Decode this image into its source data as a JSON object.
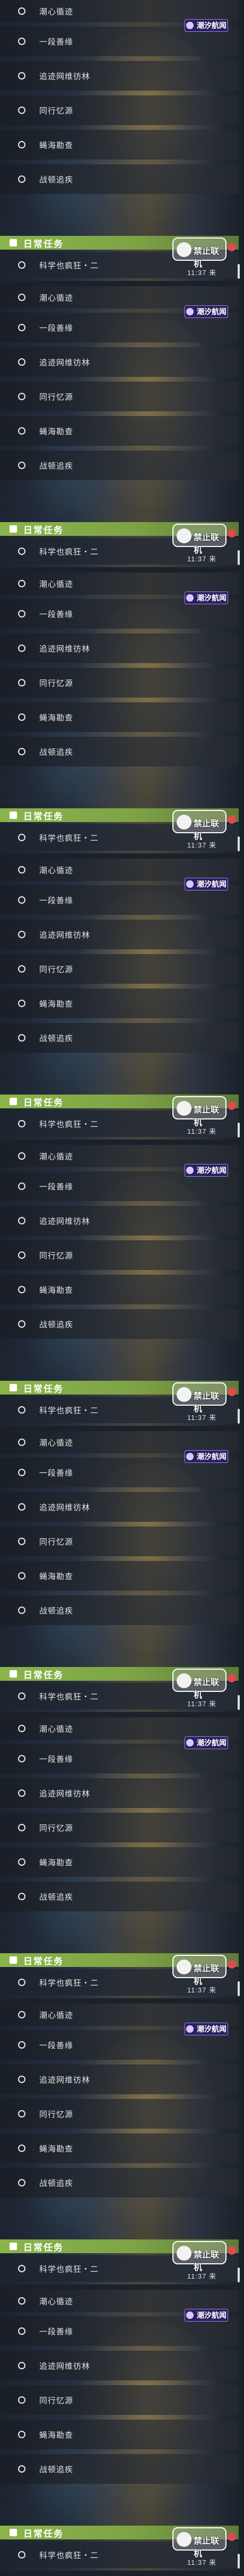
{
  "panel_count": 9,
  "badge_label": "潮汐航闻",
  "daily_label": "日常任务",
  "ban_label": "禁止联机",
  "task_label": "科学也疯狂・二",
  "time_label": "11:37 来",
  "items": [
    "潮心循迹",
    "一段善缘",
    "追迹网维彷林",
    "同行忆源",
    "蝇海勘查",
    "战顿追疾"
  ],
  "colors": {
    "daily_bar": "#8bb44a",
    "badge_bg": "#2a2060",
    "ban_dot": "#e04a50"
  },
  "icons": {
    "daily": "calendar-icon",
    "ban": "face-icon",
    "badge": "tidal-icon",
    "item": "circle-icon"
  }
}
